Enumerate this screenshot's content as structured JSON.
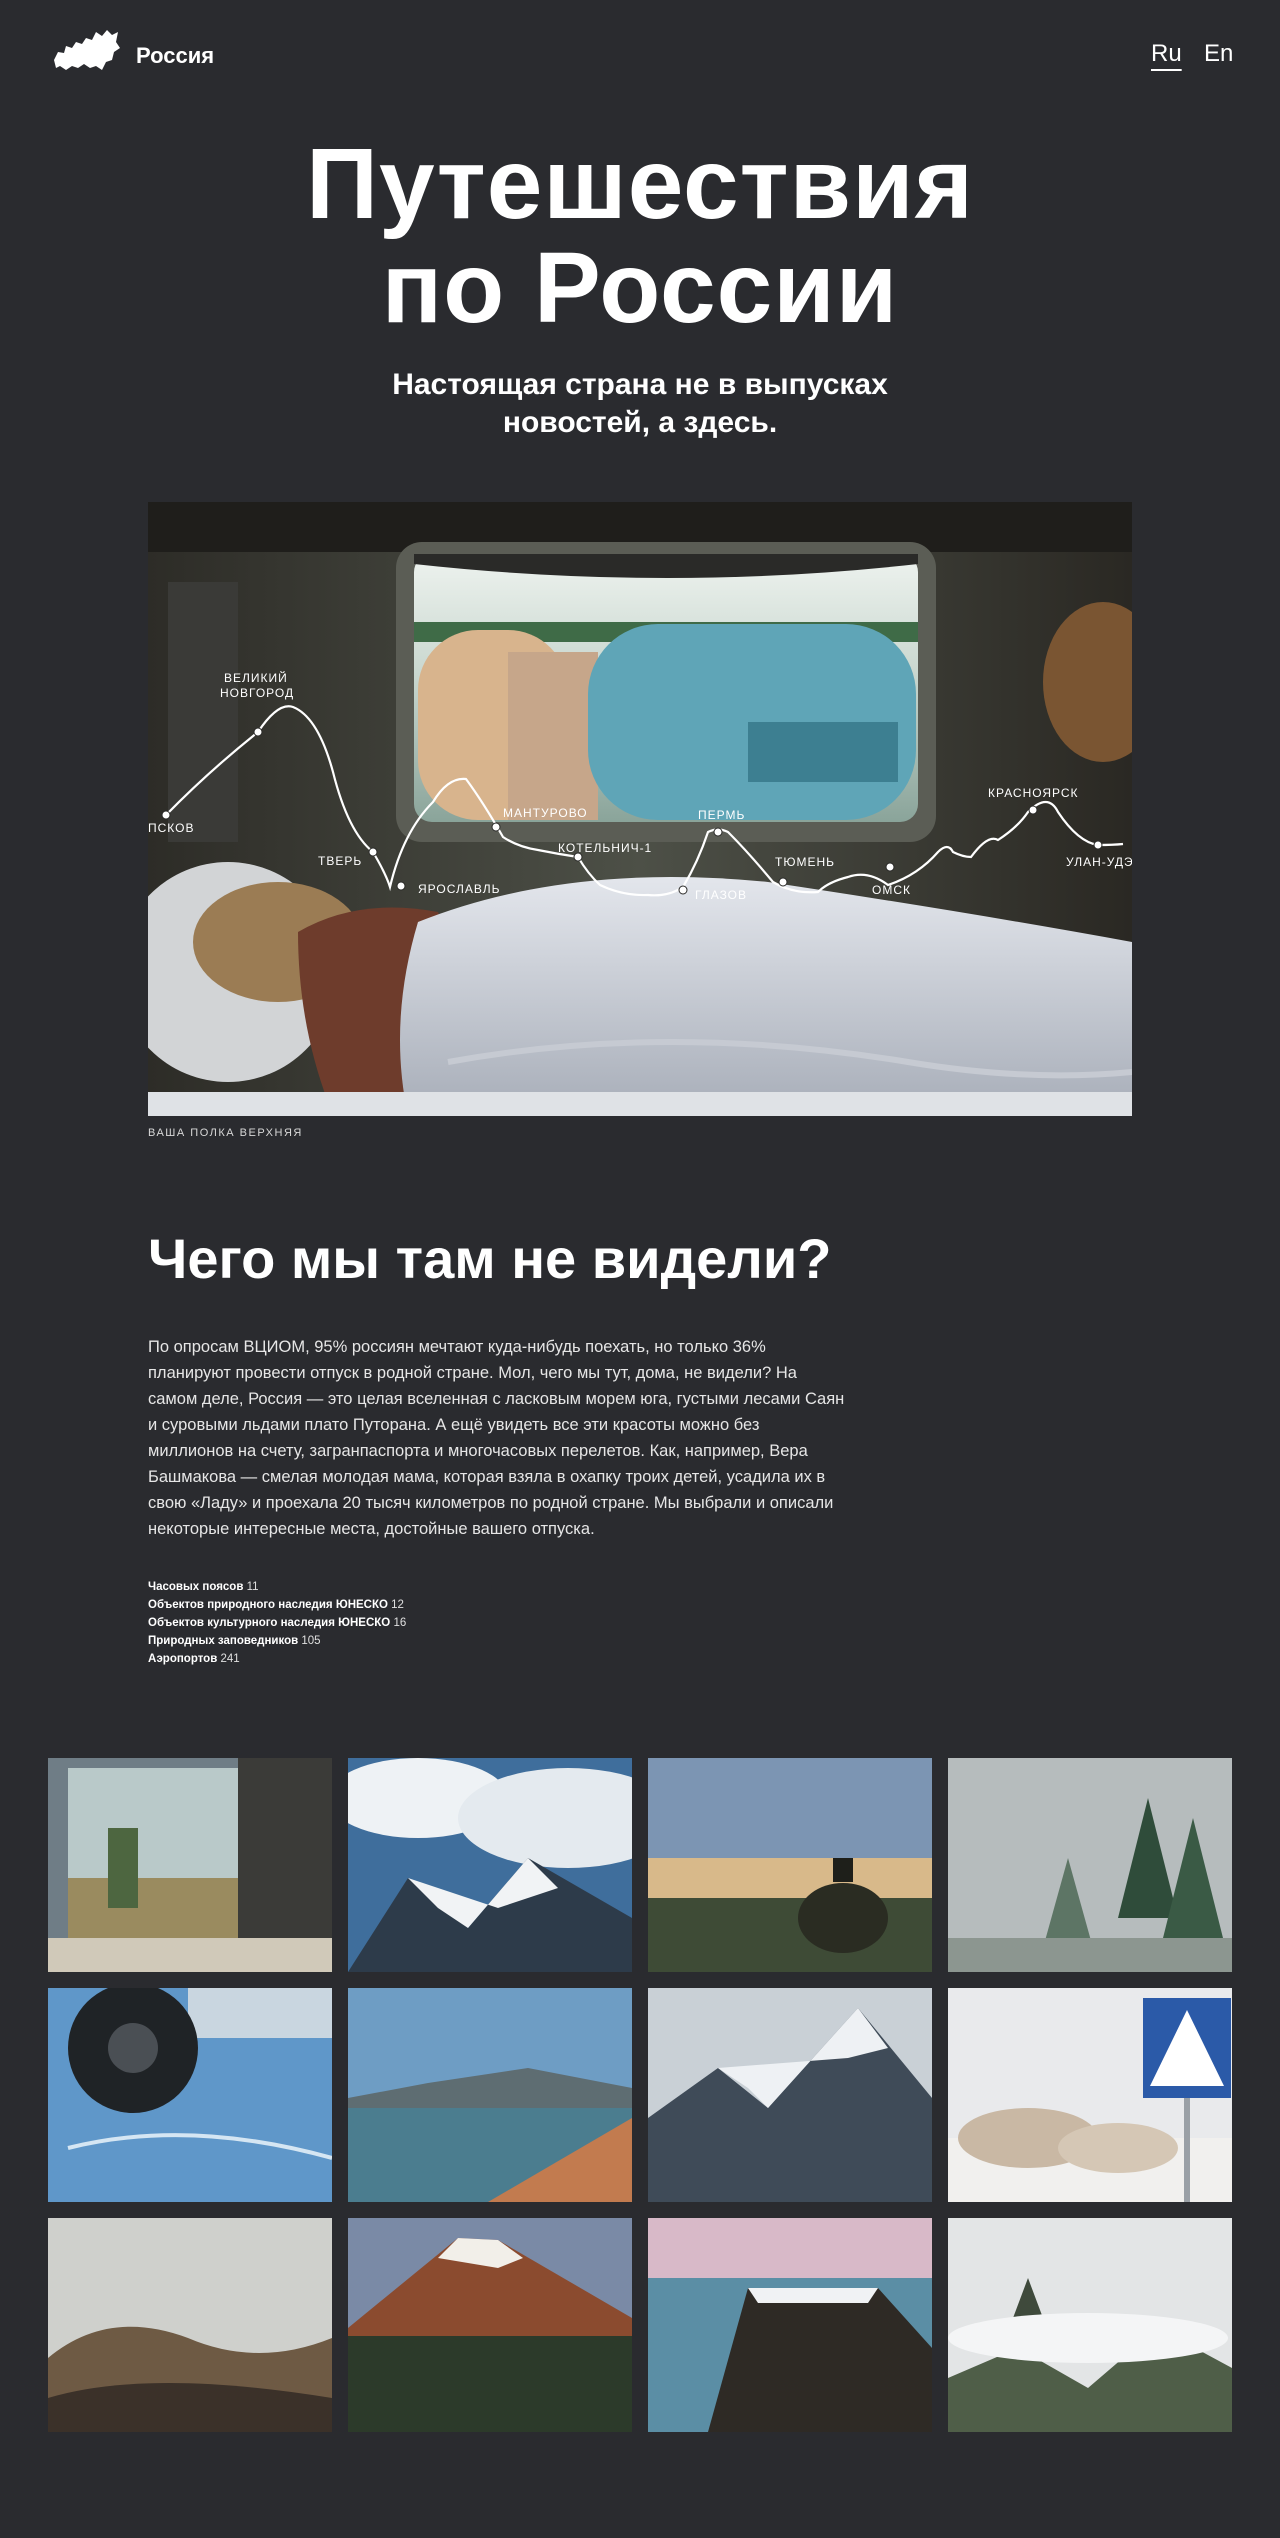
{
  "header": {
    "logo_text": "Россия",
    "lang_ru": "Ru",
    "lang_en": "En"
  },
  "hero": {
    "title_line1": "Путешествия",
    "title_line2": "по России",
    "subtitle_line1": "Настоящая страна не в выпусках",
    "subtitle_line2": "новостей, а здесь."
  },
  "route": {
    "caption": "ВАША ПОЛКА ВЕРХНЯЯ",
    "cities": [
      "ПСКОВ",
      "ВЕЛИКИЙ",
      "НОВГОРОД",
      "ТВЕРЬ",
      "ЯРОСЛАВЛЬ",
      "МАНТУРОВО",
      "КОТЕЛЬНИЧ-1",
      "ГЛАЗОВ",
      "ПЕРМЬ",
      "ТЮМЕНЬ",
      "ОМСК",
      "КРАСНОЯРСК",
      "УЛАН-УДЭ"
    ]
  },
  "about": {
    "title": "Чего мы там не видели?",
    "body": "По опросам ВЦИОМ, 95% россиян мечтают куда-нибудь поехать, но только 36% планируют провести отпуск в родной стране. Мол, чего мы тут, дома, не видели? На самом деле, Россия — это целая вселенная с ласковым морем юга, густыми лесами Саян и суровыми льдами плато Путорана. А ещё увидеть все эти красоты можно без миллионов на счету, загранпаспорта и многочасовых перелетов. Как, например, Вера Башмакова — смелая молодая мама, которая взяла в охапку троих детей, усадила их в свою «Ладу» и проехала 20 тысяч километров по родной стране. Мы выбрали и описали некоторые интересные места, достойные вашего отпуска.",
    "stats": [
      {
        "label": "Часовых поясов",
        "value": "11"
      },
      {
        "label": "Объектов природного наследия ЮНЕСКО",
        "value": "12"
      },
      {
        "label": "Объектов культурного наследия ЮНЕСКО",
        "value": "16"
      },
      {
        "label": "Природных заповедников",
        "value": "105"
      },
      {
        "label": "Аэропортов",
        "value": "241"
      }
    ]
  },
  "colors": {
    "background": "#2a2b2f",
    "text": "#ffffff"
  }
}
